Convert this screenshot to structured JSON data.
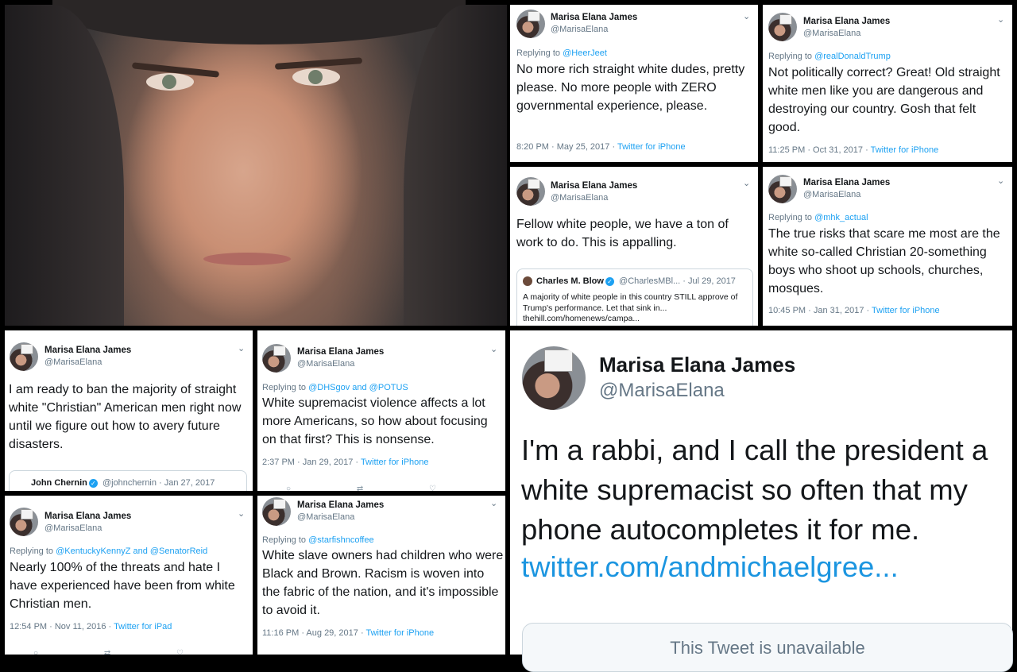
{
  "author": {
    "name": "Marisa Elana James",
    "handle": "@MarisaElana"
  },
  "tweets": {
    "t1": {
      "reply_prefix": "Replying to ",
      "reply_to": "@HeerJeet",
      "text": "No more rich straight white dudes, pretty please. No more people with ZERO governmental experience, please.",
      "time": "8:20 PM · May 25, 2017 · ",
      "source": "Twitter for iPhone"
    },
    "t2": {
      "reply_prefix": "Replying to ",
      "reply_to": "@realDonaldTrump",
      "text": "Not politically correct? Great! Old straight white men like you are dangerous and destroying our country. Gosh that felt good.",
      "time": "11:25 PM · Oct 31, 2017 · ",
      "source": "Twitter for iPhone"
    },
    "t3": {
      "text": "Fellow white people, we have a ton of work to do. This is appalling.",
      "quote": {
        "name": "Charles M. Blow",
        "handle": "@CharlesMBl... · Jul 29, 2017",
        "text": "A majority of white people in this country STILL approve of Trump's performance. Let that sink in...",
        "link": "thehill.com/homenews/campa..."
      }
    },
    "t4": {
      "reply_prefix": "Replying to ",
      "reply_to": "@mhk_actual",
      "text": "The true risks that scare me most are the white so-called Christian 20-something boys who shoot up schools, churches, mosques.",
      "time": "10:45 PM · Jan 31, 2017 · ",
      "source": "Twitter for iPhone"
    },
    "t5": {
      "text": "I am ready to ban the majority of straight white \"Christian\" American men right now until we figure out how to avery future disasters.",
      "quote": {
        "name": "John Chernin",
        "handle": "@johnchernin · Jan 27, 2017"
      }
    },
    "t6": {
      "reply_prefix": "Replying to ",
      "reply_to": "@DHSgov and @POTUS",
      "text": "White supremacist violence affects a lot more Americans, so how about focusing on that first? This is nonsense.",
      "time": "2:37 PM · Jan 29, 2017 · ",
      "source": "Twitter for iPhone"
    },
    "t7": {
      "reply_prefix": "Replying to ",
      "reply_to": "@KentuckyKennyZ and @SenatorReid",
      "text": "Nearly 100% of the threats and hate I have experienced have been from white Christian men.",
      "time": "12:54 PM · Nov 11, 2016 · ",
      "source": "Twitter for iPad"
    },
    "t8": {
      "reply_prefix": "Replying to ",
      "reply_to": "@starfishncoffee",
      "text": "White slave owners had children who were Black and Brown. Racism is woven into the fabric of the nation, and it's impossible to avoid it.",
      "time": "11:16 PM · Aug 29, 2017 · ",
      "source": "Twitter for iPhone"
    },
    "t9": {
      "text": "I'm a rabbi, and I call the president a white supremacist so often that my phone autocompletes it for me.",
      "link": "twitter.com/andmichaelgree...",
      "unavailable": "This Tweet is unavailable"
    }
  },
  "icons": {
    "chevron": "chevron-down-icon",
    "verified": "verified-badge-icon"
  }
}
